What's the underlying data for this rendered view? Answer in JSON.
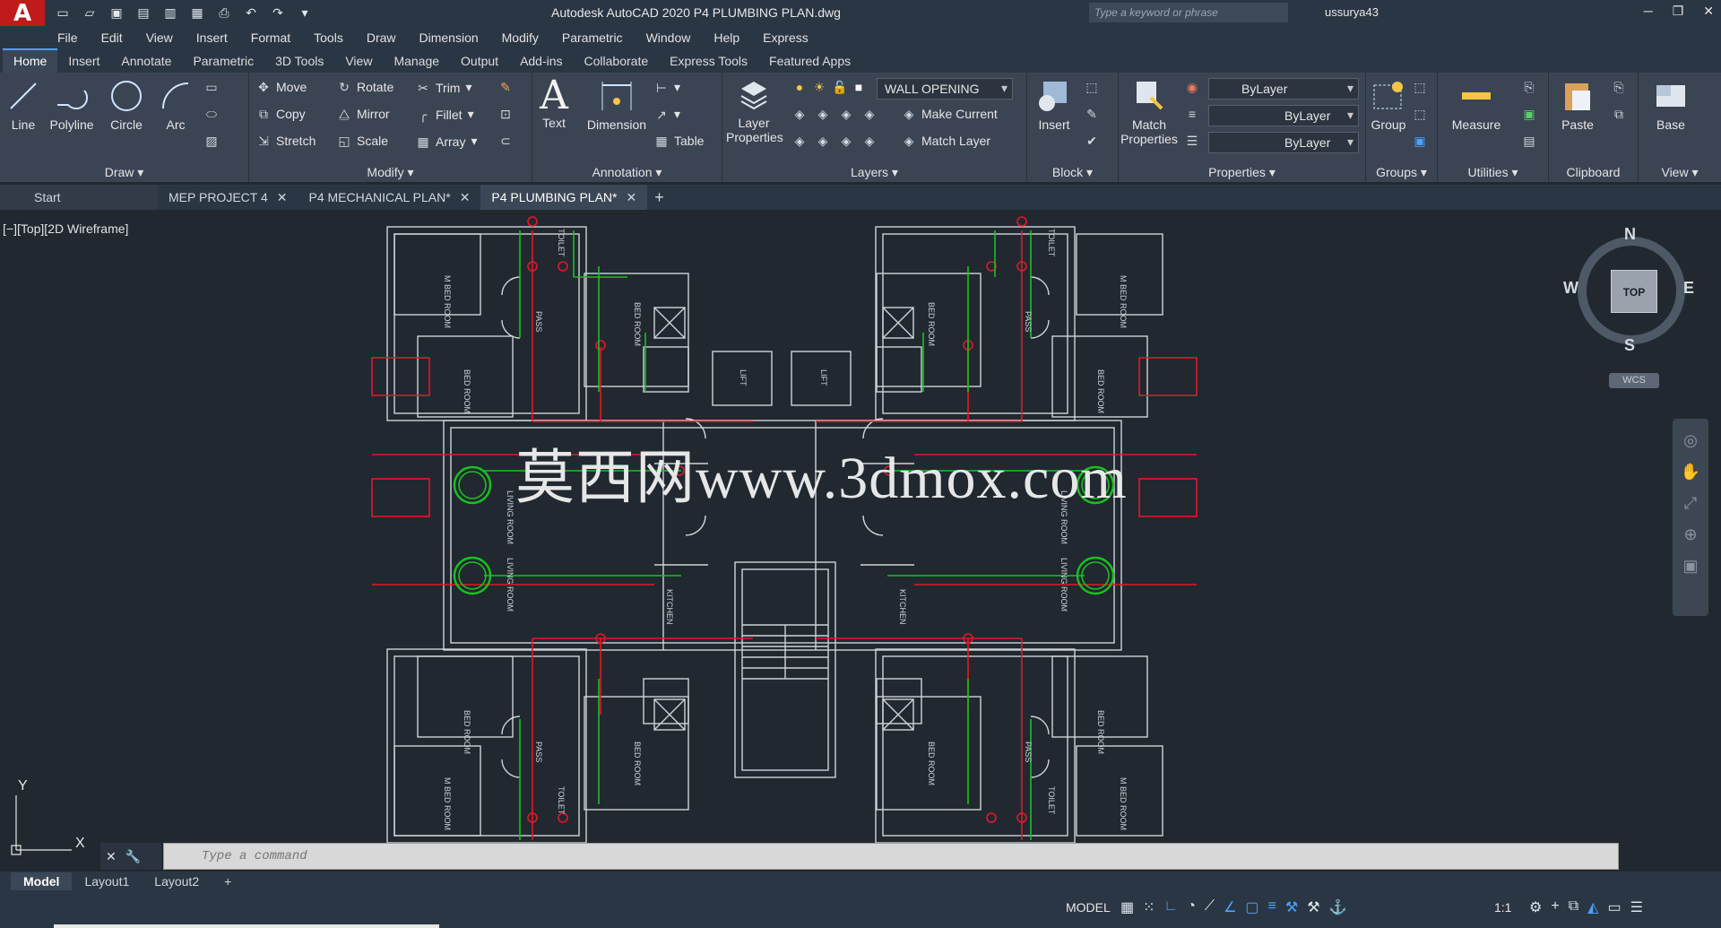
{
  "title": {
    "app_logo": "A",
    "window_title": "Autodesk AutoCAD 2020    P4 PLUMBING PLAN.dwg",
    "search_placeholder": "Type a keyword or phrase",
    "user": "ussurya43"
  },
  "menu": [
    "File",
    "Edit",
    "View",
    "Insert",
    "Format",
    "Tools",
    "Draw",
    "Dimension",
    "Modify",
    "Parametric",
    "Window",
    "Help",
    "Express"
  ],
  "ribbon_tabs": [
    "Home",
    "Insert",
    "Annotate",
    "Parametric",
    "3D Tools",
    "View",
    "Manage",
    "Output",
    "Add-ins",
    "Collaborate",
    "Express Tools",
    "Featured Apps"
  ],
  "panels": {
    "draw": {
      "title": "Draw",
      "line": "Line",
      "polyline": "Polyline",
      "circle": "Circle",
      "arc": "Arc"
    },
    "modify": {
      "title": "Modify",
      "move": "Move",
      "rotate": "Rotate",
      "trim": "Trim",
      "copy": "Copy",
      "mirror": "Mirror",
      "fillet": "Fillet",
      "stretch": "Stretch",
      "scale": "Scale",
      "array": "Array"
    },
    "annotation": {
      "title": "Annotation",
      "text": "Text",
      "dimension": "Dimension",
      "table": "Table"
    },
    "layers": {
      "title": "Layers",
      "layer_properties_1": "Layer",
      "layer_properties_2": "Properties",
      "current_layer": "WALL OPENING",
      "make_current": "Make Current",
      "match_layer": "Match Layer"
    },
    "block": {
      "title": "Block",
      "insert": "Insert"
    },
    "properties": {
      "title": "Properties",
      "match_1": "Match",
      "match_2": "Properties",
      "color": "ByLayer",
      "linetype": "ByLayer",
      "lineweight": "ByLayer"
    },
    "groups": {
      "title": "Groups",
      "group": "Group"
    },
    "utilities": {
      "title": "Utilities",
      "measure": "Measure"
    },
    "clipboard": {
      "title": "Clipboard",
      "paste": "Paste"
    },
    "view": {
      "title": "View",
      "base": "Base"
    }
  },
  "doc_tabs": {
    "start": "Start",
    "tabs": [
      "MEP PROJECT 4",
      "P4 MECHANICAL PLAN*",
      "P4 PLUMBING PLAN*"
    ]
  },
  "viewport_label": "[−][Top][2D Wireframe]",
  "watermark": "莫西网www.3dmox.com",
  "viewcube": {
    "n": "N",
    "s": "S",
    "e": "E",
    "w": "W",
    "top": "TOP",
    "wcs": "WCS"
  },
  "ucs": {
    "y": "Y",
    "x": "X"
  },
  "command": {
    "placeholder": "Type a command"
  },
  "layout_tabs": [
    "Model",
    "Layout1",
    "Layout2"
  ],
  "status": {
    "model": "MODEL",
    "scale": "1:1"
  },
  "room_labels": {
    "m_bed": "M BED ROOM",
    "bed": "BED ROOM",
    "pass": "PASS",
    "living": "LIVING ROOM",
    "kitchen": "KITCHEN",
    "toilet": "TOILET",
    "lift": "LIFT"
  },
  "colors": {
    "wall": "#cfd3d8",
    "supply": "#19c21f",
    "drain": "#e0192a",
    "accent": "#4aa3ff",
    "bg": "#212830"
  }
}
